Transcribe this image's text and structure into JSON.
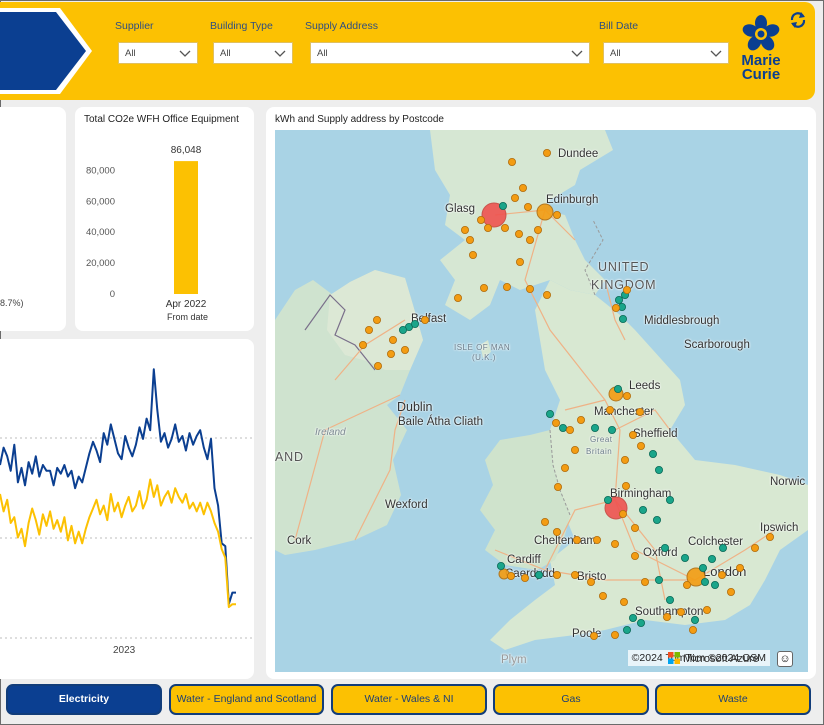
{
  "filters": {
    "supplier": {
      "label": "Supplier",
      "value": "All"
    },
    "building_type": {
      "label": "Building Type",
      "value": "All"
    },
    "supply_address": {
      "label": "Supply Address",
      "value": "All"
    },
    "bill_date": {
      "label": "Bill Date",
      "value": "All"
    }
  },
  "logo": {
    "line1": "Marie",
    "line2": "Curie"
  },
  "partial_card": {
    "text": "8.7%)"
  },
  "co2_card": {
    "title": "Total CO2e WFH Office Equipment",
    "sublabel": "From date"
  },
  "line_card": {
    "xlabel": "2023"
  },
  "map_card": {
    "title": "kWh and Supply address by Postcode",
    "attribution": "©2024 TomTom  ©2024 OSM",
    "azure": "Microsoft Azure",
    "labels": {
      "dundee": "Dundee",
      "glasgow": "Glasg",
      "edinburgh": "Edinburgh",
      "united": "UNITED",
      "kingdom": "KINGDOM",
      "belfast": "Belfast",
      "isle_of_man": "ISLE OF MAN",
      "uk": "(U.K.)",
      "middlesbrough": "Middlesbrough",
      "scarborough": "Scarborough",
      "leeds": "Leeds",
      "manchester": "Manchester",
      "sheffield": "Sheffield",
      "great": "Great",
      "britain": "Britain",
      "dublin": "Dublin",
      "baile": "Baile Átha Cliath",
      "ireland": "Ireland",
      "and": "AND",
      "birmingham": "Birmingham",
      "norwich": "Norwic",
      "wexford": "Wexford",
      "ipswich": "Ipswich",
      "cork": "Cork",
      "colchester": "Colchester",
      "cheltenham": "Cheltenham",
      "oxford": "Oxford",
      "cardiff": "Cardiff",
      "caerdydd": "Caerdydd",
      "bristol": "Bristo",
      "london": "London",
      "southampton": "Southampton",
      "poole": "Poole",
      "plymouth": "Plym"
    }
  },
  "tabs": [
    "Electricity",
    "Water - England and Scotland",
    "Water - Wales & NI",
    "Gas",
    "Waste"
  ],
  "colors": {
    "accent": "#fcc102",
    "brand": "#0b3f91",
    "marker_orange": "#f39c12",
    "marker_teal": "#1aa58a",
    "marker_red": "#ef5350"
  },
  "chart_data": [
    {
      "type": "bar",
      "title": "Total CO2e WFH Office Equipment",
      "categories": [
        "Apr 2022"
      ],
      "values": [
        86048
      ],
      "value_labels": [
        "86,048"
      ],
      "ylim": [
        0,
        90000
      ],
      "yticks": [
        "0",
        "20,000",
        "40,000",
        "60,000",
        "80,000"
      ],
      "xlabel": "From date",
      "ylabel": "",
      "grid": false,
      "color": "#fcc102"
    },
    {
      "type": "line",
      "title": "",
      "xlabel": "",
      "ylabel": "",
      "x_tick_labels": [
        "2023"
      ],
      "grid": true,
      "ylim": [
        0,
        100
      ],
      "series": [
        {
          "color": "#0b3f91",
          "values": [
            60,
            66,
            63,
            58,
            67,
            54,
            59,
            53,
            61,
            57,
            63,
            56,
            60,
            58,
            58,
            53,
            59,
            57,
            60,
            56,
            58,
            52,
            56,
            54,
            59,
            64,
            68,
            65,
            61,
            71,
            67,
            74,
            69,
            64,
            62,
            70,
            66,
            63,
            67,
            73,
            69,
            76,
            72,
            93,
            79,
            68,
            71,
            66,
            69,
            74,
            68,
            70,
            65,
            71,
            67,
            70,
            72,
            66,
            62,
            69,
            52,
            46,
            33,
            32,
            12,
            16,
            16
          ]
        },
        {
          "color": "#fcc102",
          "values": [
            50,
            44,
            48,
            40,
            42,
            35,
            38,
            32,
            40,
            45,
            41,
            36,
            43,
            39,
            44,
            38,
            41,
            37,
            42,
            34,
            39,
            33,
            37,
            33,
            38,
            42,
            45,
            48,
            43,
            46,
            41,
            50,
            44,
            47,
            42,
            46,
            49,
            44,
            46,
            51,
            45,
            48,
            55,
            49,
            53,
            46,
            49,
            51,
            47,
            52,
            49,
            47,
            50,
            45,
            47,
            44,
            47,
            43,
            47,
            44,
            40,
            37,
            31,
            28,
            11,
            12,
            12
          ]
        }
      ]
    }
  ]
}
